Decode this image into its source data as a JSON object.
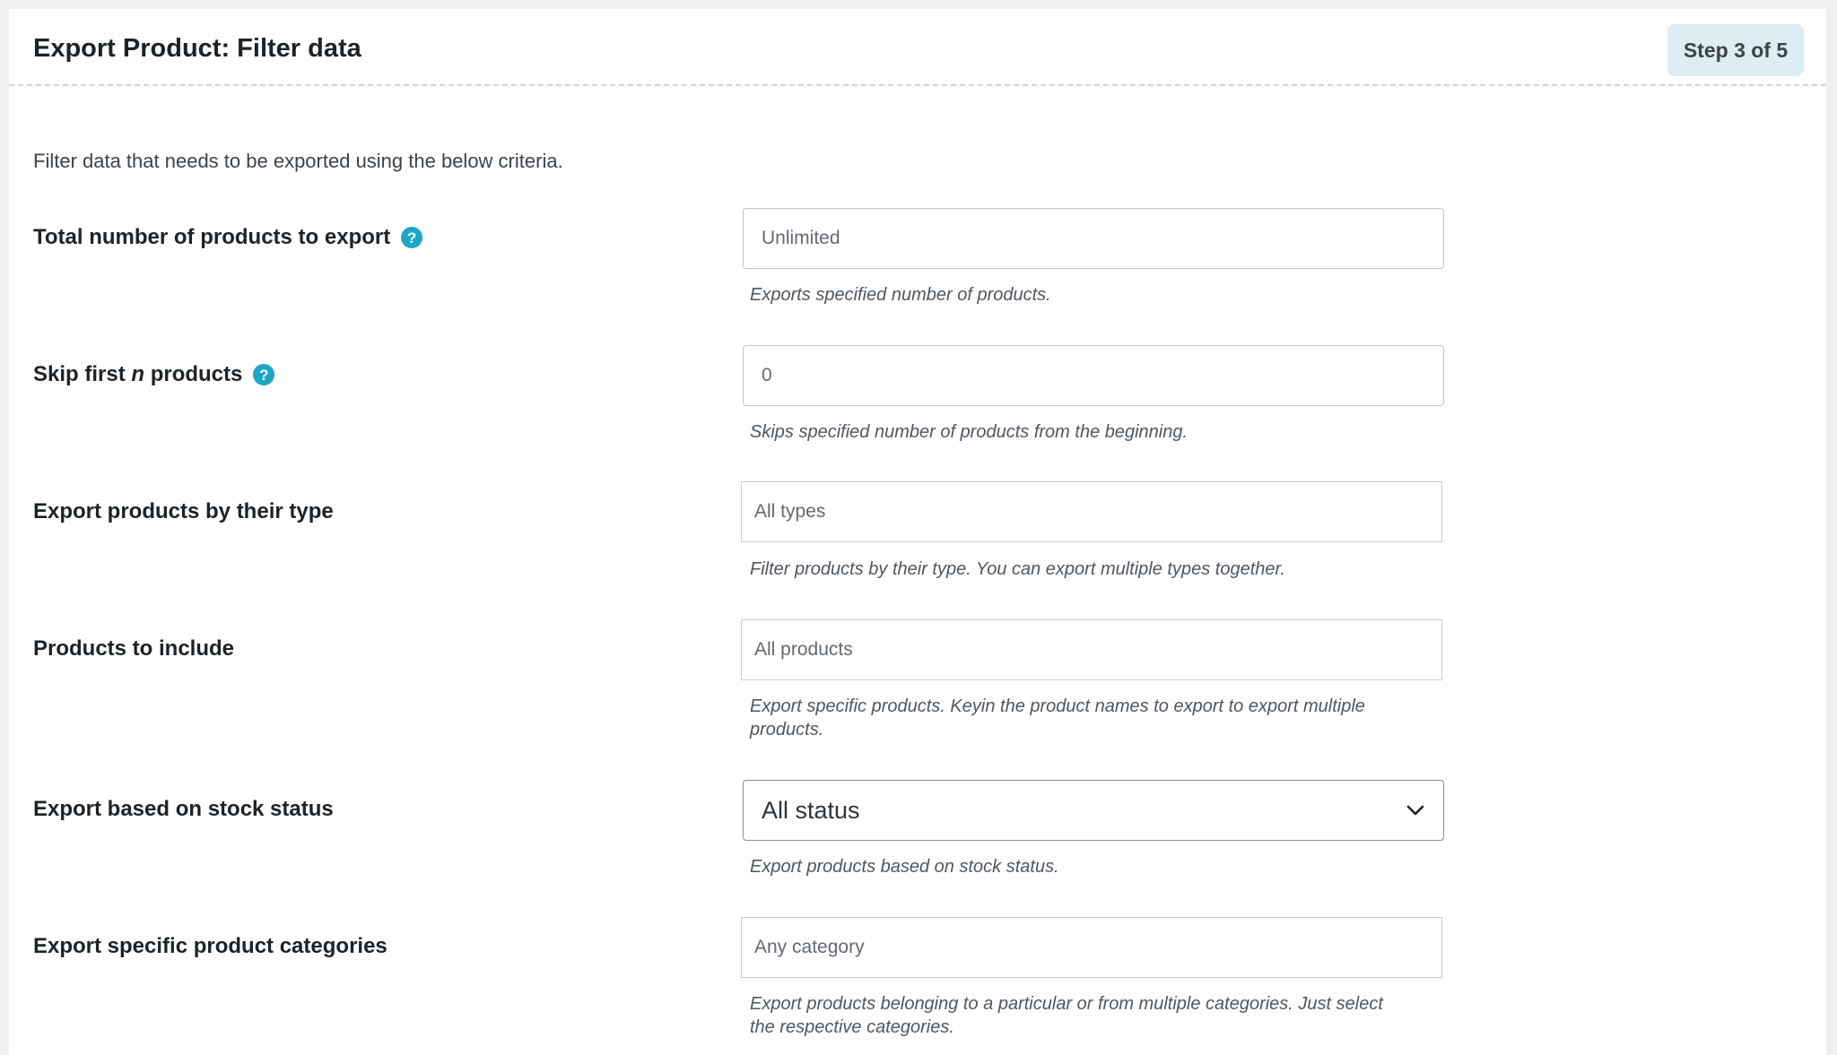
{
  "header": {
    "title": "Export Product: Filter data",
    "step": "Step 3 of 5"
  },
  "intro": "Filter data that needs to be exported using the below criteria.",
  "fields": {
    "total": {
      "label": "Total number of products to export",
      "placeholder": "Unlimited",
      "description": "Exports specified number of products.",
      "help_icon": "question-mark"
    },
    "skip": {
      "label_prefix": "Skip first ",
      "label_var": "n",
      "label_suffix": " products",
      "placeholder": "0",
      "description": "Skips specified number of products from the beginning.",
      "help_icon": "question-mark"
    },
    "types": {
      "label": "Export products by their type",
      "placeholder": "All types",
      "description": "Filter products by their type. You can export multiple types together."
    },
    "include": {
      "label": "Products to include",
      "placeholder": "All products",
      "description_line1": "Export specific products. Keyin the product names to export to export multiple",
      "description_line2": "products."
    },
    "stock": {
      "label": "Export based on stock status",
      "selected": "All status",
      "description": "Export products based on stock status.",
      "icon": "chevron-down"
    },
    "categories": {
      "label": "Export specific product categories",
      "placeholder": "Any category",
      "description_line1": "Export products belonging to a particular or from multiple categories. Just select",
      "description_line2": "the respective categories."
    }
  },
  "colors": {
    "help_icon": "#1ea7c5",
    "step_badge_bg": "#dcedf3",
    "page_bg": "#f0f0f1"
  }
}
